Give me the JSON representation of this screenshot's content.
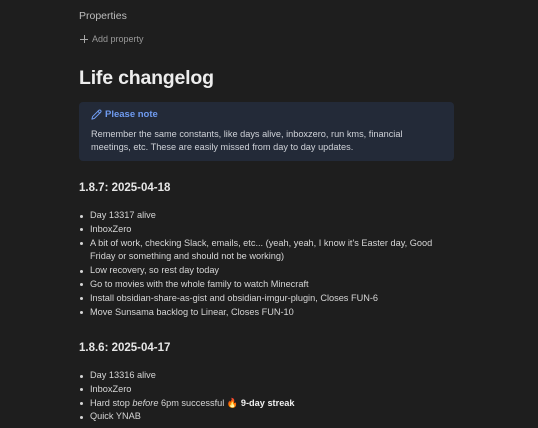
{
  "properties": {
    "title": "Properties",
    "add_label": "Add property"
  },
  "note": {
    "title": "Life changelog",
    "callout": {
      "heading": "Please note",
      "body": "Remember the same constants, like days alive, inboxzero, run kms, financial meetings, etc. These are easily missed from day to day updates."
    },
    "sections": [
      {
        "heading": "1.8.7: 2025-04-18",
        "items": [
          "Day 13317 alive",
          "InboxZero",
          "A bit of work, checking Slack, emails, etc... (yeah, yeah, I know it's Easter day, Good Friday or something and should not be working)",
          "Low recovery, so rest day today",
          "Go to movies with the whole family to watch Minecraft",
          "Install obsidian-share-as-gist and obsidian-imgur-plugin, Closes FUN-6",
          "Move Sunsama backlog to Linear, Closes FUN-10"
        ]
      },
      {
        "heading": "1.8.6: 2025-04-17",
        "items": [
          "Day 13316 alive",
          "InboxZero",
          {
            "prefix": "Hard stop ",
            "emphasis": "before",
            "middle": " 6pm successful ",
            "emoji": "🔥",
            "strong": "9-day streak"
          },
          "Quick YNAB"
        ]
      }
    ]
  },
  "colors": {
    "background": "#1e1e1e",
    "callout_bg": "#232a38",
    "accent": "#6f9bf0",
    "text": "#d6d6d6"
  }
}
